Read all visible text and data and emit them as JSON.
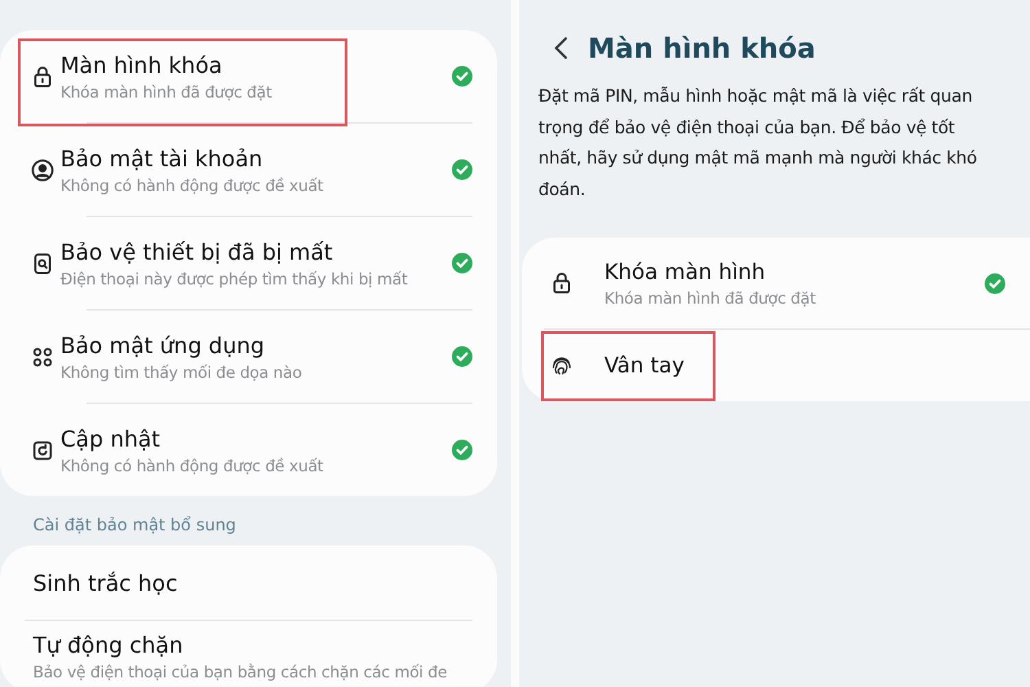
{
  "left_screen": {
    "security_items": [
      {
        "title": "Màn hình khóa",
        "subtitle": "Khóa màn hình đã được đặt",
        "checked": true,
        "highlighted": true
      },
      {
        "title": "Bảo mật tài khoản",
        "subtitle": "Không có hành động được đề xuất",
        "checked": true,
        "highlighted": false
      },
      {
        "title": "Bảo vệ thiết bị đã bị mất",
        "subtitle": "Điện thoại này được phép tìm thấy khi bị mất",
        "checked": true,
        "highlighted": false
      },
      {
        "title": "Bảo mật ứng dụng",
        "subtitle": "Không tìm thấy mối đe dọa nào",
        "checked": true,
        "highlighted": false
      },
      {
        "title": "Cập nhật",
        "subtitle": "Không có hành động được đề xuất",
        "checked": true,
        "highlighted": false
      }
    ],
    "section_header": "Cài đặt bảo mật bổ sung",
    "extra_items": [
      {
        "title": "Sinh trắc học"
      },
      {
        "title": "Tự động chặn",
        "subtitle": "Bảo vệ điện thoại của bạn bằng cách chặn các mối đe"
      }
    ]
  },
  "right_screen": {
    "title": "Màn hình khóa",
    "description": "Đặt mã PIN, mẫu hình hoặc mật mã là việc rất quan trọng để bảo vệ điện thoại của bạn. Để bảo vệ tốt nhất, hãy sử dụng mật mã mạnh mà người khác khó đoán.",
    "items": [
      {
        "title": "Khóa màn hình",
        "subtitle": "Khóa màn hình đã được đặt",
        "checked": true,
        "highlighted": false
      },
      {
        "title": "Vân tay",
        "checked": false,
        "highlighted": true
      }
    ]
  }
}
